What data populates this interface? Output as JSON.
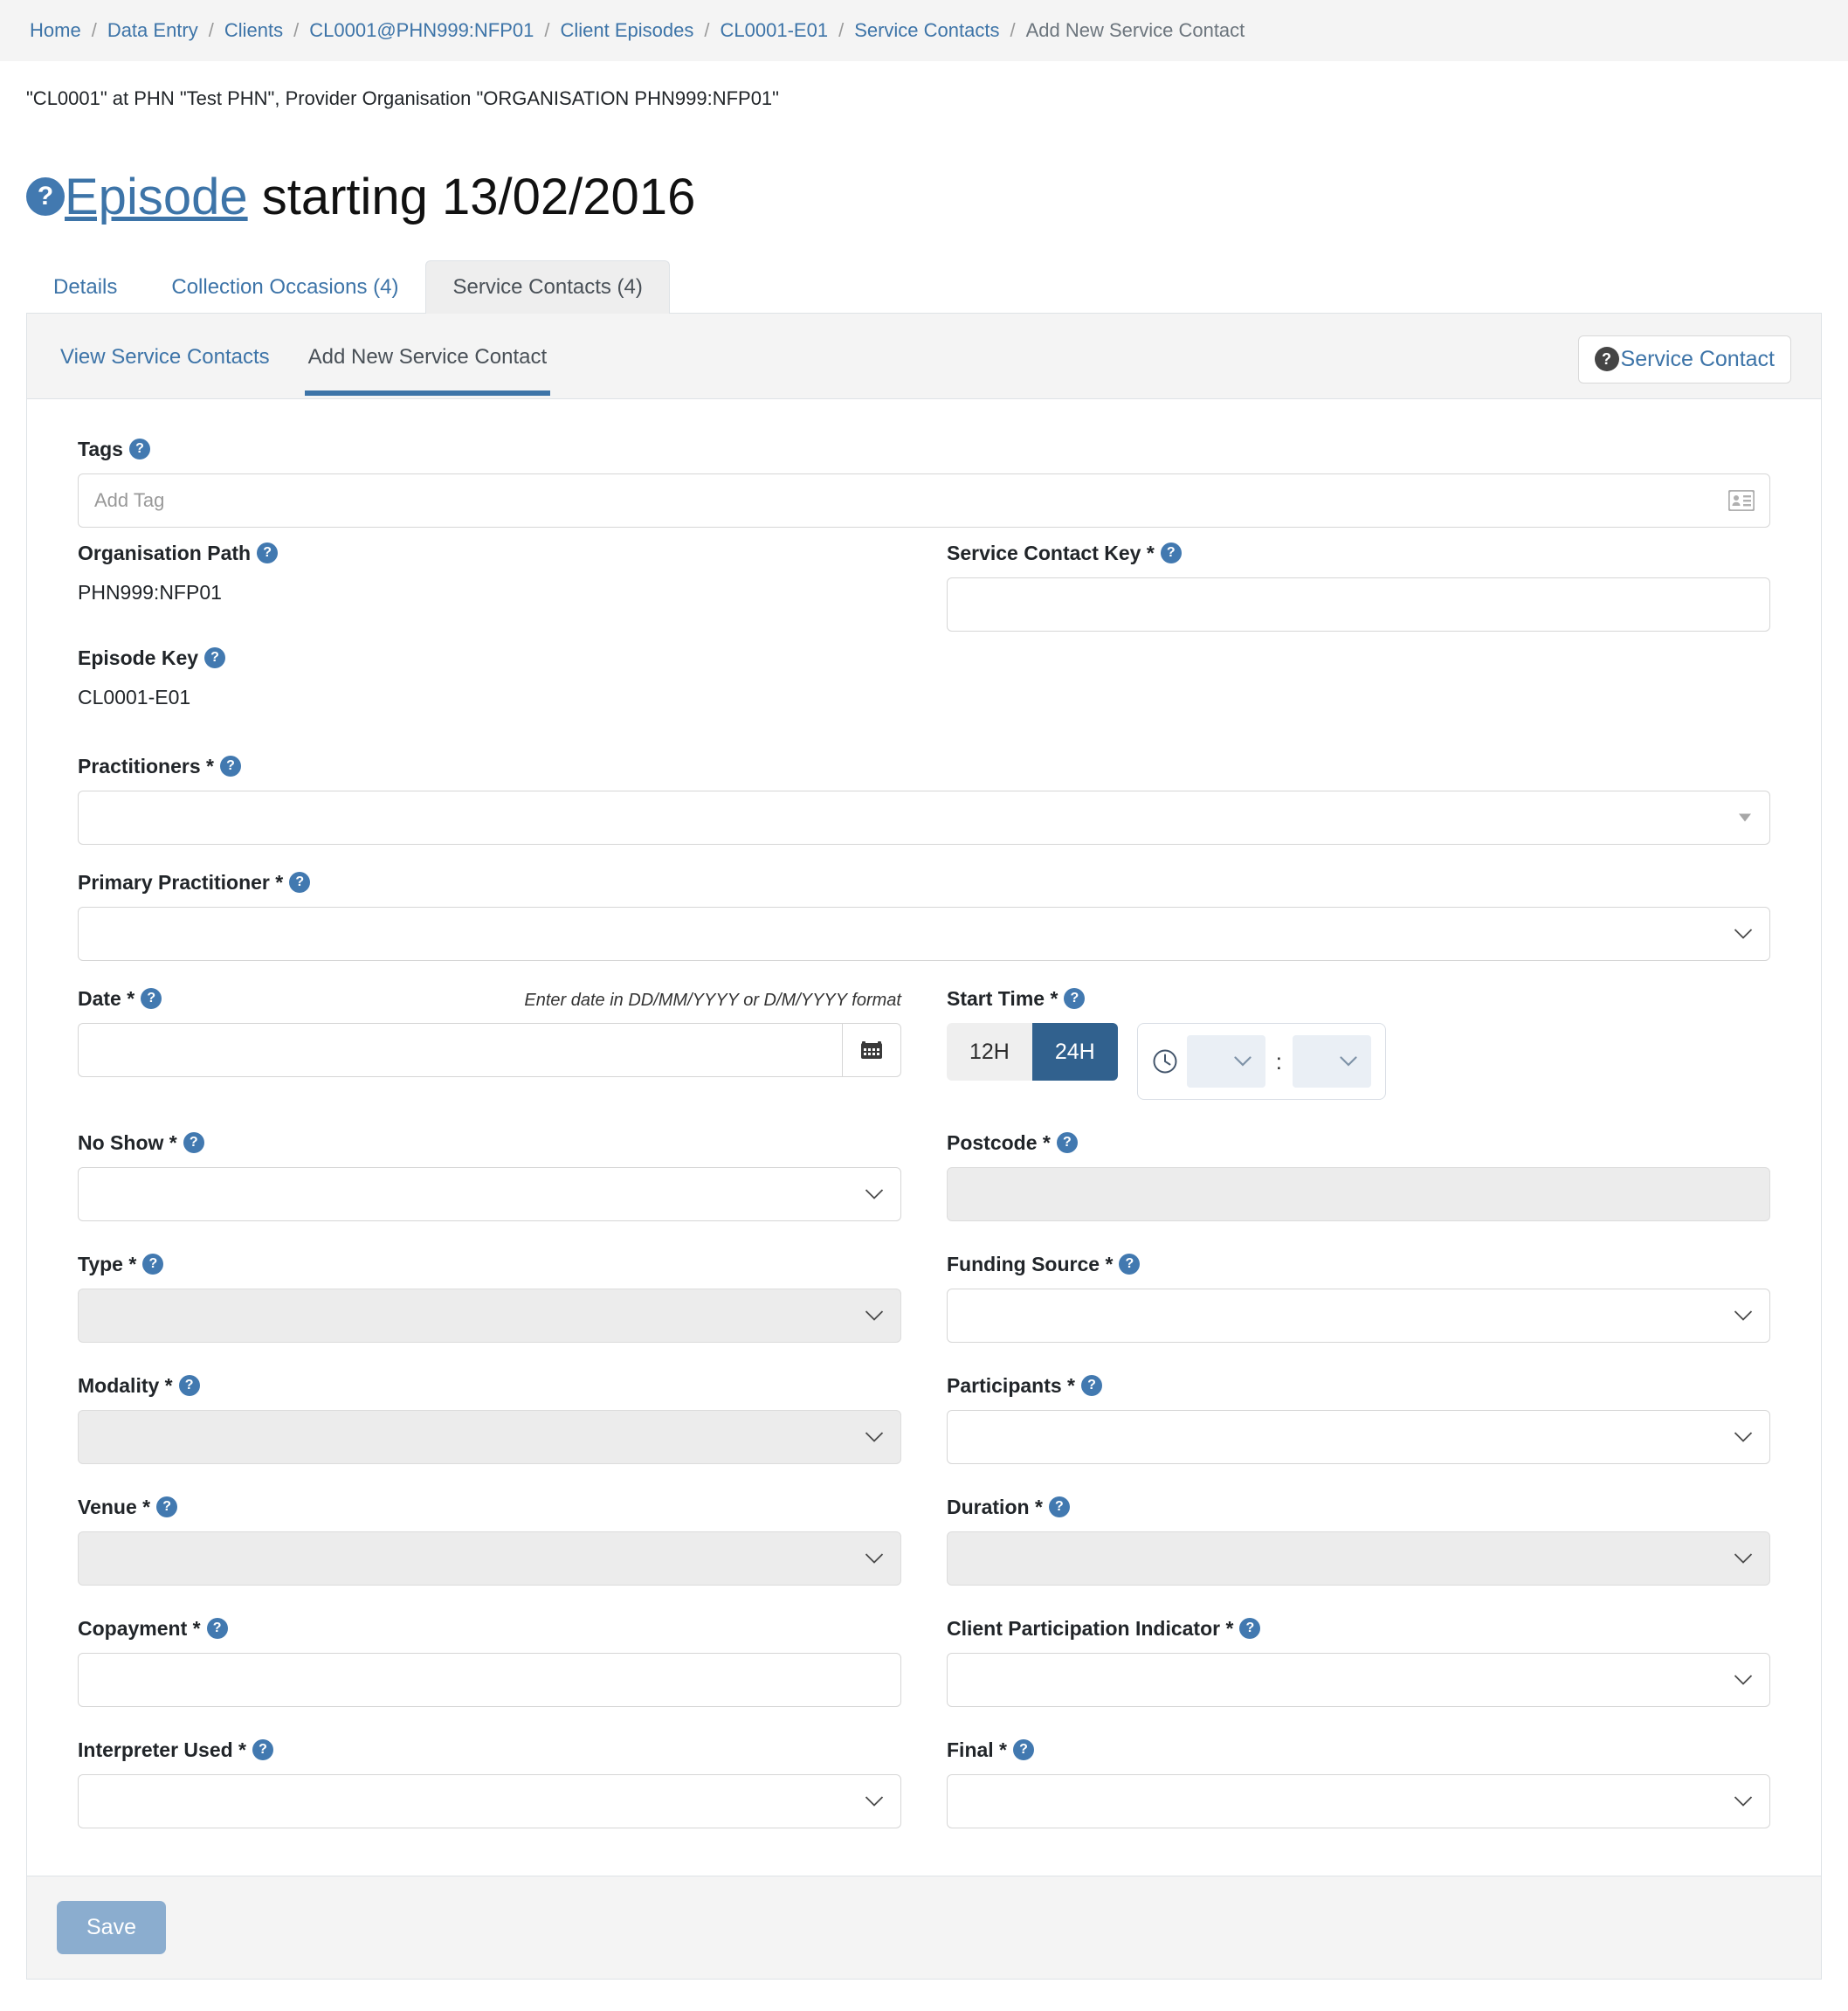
{
  "breadcrumb": {
    "items": [
      {
        "label": "Home",
        "link": true
      },
      {
        "label": "Data Entry",
        "link": true
      },
      {
        "label": "Clients",
        "link": true
      },
      {
        "label": "CL0001@PHN999:NFP01",
        "link": true
      },
      {
        "label": "Client Episodes",
        "link": true
      },
      {
        "label": "CL0001-E01",
        "link": true
      },
      {
        "label": "Service Contacts",
        "link": true
      },
      {
        "label": "Add New Service Contact",
        "link": false
      }
    ],
    "separator": "/"
  },
  "context_line": "\"CL0001\" at PHN \"Test PHN\", Provider Organisation \"ORGANISATION PHN999:NFP01\"",
  "page_title": {
    "help_icon": "question-mark-icon",
    "link_text": "Episode",
    "rest_text": " starting 13/02/2016"
  },
  "tabs": [
    {
      "label": "Details",
      "active": false
    },
    {
      "label": "Collection Occasions (4)",
      "active": false
    },
    {
      "label": "Service Contacts (4)",
      "active": true
    }
  ],
  "subtabs": [
    {
      "label": "View Service Contacts",
      "active": false
    },
    {
      "label": "Add New Service Contact",
      "active": true
    }
  ],
  "help_button": {
    "icon": "question-mark-icon",
    "label": "Service Contact"
  },
  "form": {
    "tags": {
      "label": "Tags",
      "placeholder": "Add Tag",
      "value": "",
      "icon": "address-card-icon"
    },
    "organisation_path": {
      "label": "Organisation Path",
      "value": "PHN999:NFP01"
    },
    "service_contact_key": {
      "label": "Service Contact Key *",
      "value": ""
    },
    "episode_key": {
      "label": "Episode Key",
      "value": "CL0001-E01"
    },
    "practitioners": {
      "label": "Practitioners *",
      "value": ""
    },
    "primary_practitioner": {
      "label": "Primary Practitioner *",
      "value": ""
    },
    "date": {
      "label": "Date *",
      "hint": "Enter date in DD/MM/YYYY or D/M/YYYY format",
      "value": "",
      "button_icon": "calendar-icon"
    },
    "start_time": {
      "label": "Start Time *",
      "format_options": [
        "12H",
        "24H"
      ],
      "format_selected": "24H",
      "clock_icon": "clock-icon",
      "hour_value": "",
      "minute_value": "",
      "separator": ":"
    },
    "no_show": {
      "label": "No Show *",
      "value": ""
    },
    "postcode": {
      "label": "Postcode *",
      "value": "",
      "disabled": true
    },
    "type": {
      "label": "Type *",
      "value": "",
      "disabled": true
    },
    "funding_source": {
      "label": "Funding Source *",
      "value": ""
    },
    "modality": {
      "label": "Modality *",
      "value": "",
      "disabled": true
    },
    "participants": {
      "label": "Participants *",
      "value": ""
    },
    "venue": {
      "label": "Venue *",
      "value": "",
      "disabled": true
    },
    "duration": {
      "label": "Duration *",
      "value": "",
      "disabled": true
    },
    "copayment": {
      "label": "Copayment *",
      "value": ""
    },
    "client_participation_indicator": {
      "label": "Client Participation Indicator *",
      "value": ""
    },
    "interpreter_used": {
      "label": "Interpreter Used *",
      "value": ""
    },
    "final": {
      "label": "Final *",
      "value": ""
    }
  },
  "footer": {
    "save_label": "Save"
  },
  "colors": {
    "link": "#3d74a8",
    "help_blue": "#4279b0",
    "help_dark": "#454545",
    "accent_dark_blue": "#31618e",
    "save_button": "#8badcf",
    "panel_bg": "#f4f4f4",
    "disabled_field": "#ececec"
  }
}
